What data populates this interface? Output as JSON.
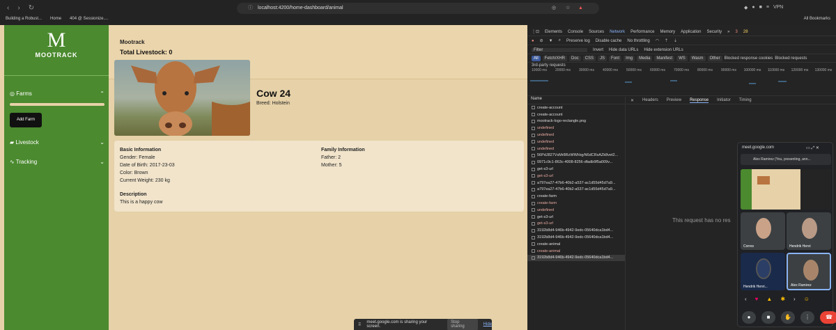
{
  "browser": {
    "back": "‹",
    "forward": "›",
    "reload": "↻",
    "url": "localhost:4200/home-dashboard/animal",
    "vpn": "VPN",
    "bookmarks": [
      "Building a Robust...",
      "Home",
      "404 @ Sessionize...."
    ],
    "all_bookmarks": "All Bookmarks"
  },
  "sidebar": {
    "logo_letter": "M",
    "logo_text": "MOOTRACK",
    "farms": "Farms",
    "add_farm": "Add Farm",
    "livestock": "Livestock",
    "tracking": "Tracking"
  },
  "header": {
    "title": "Mootrack",
    "total": "Total Livestock: 0"
  },
  "animal": {
    "name": "Cow 24",
    "breed": "Breed: Holstein",
    "basic_title": "Basic Information",
    "gender": "Gender: Female",
    "dob": "Date of Birth: 2017-23-03",
    "color": "Color: Brown",
    "weight": "Current Weight: 230 kg",
    "family_title": "Family Information",
    "father": "Father: 2",
    "mother": "Mother: 5",
    "desc_title": "Description",
    "desc": "This is a happy cow"
  },
  "devtools": {
    "tabs": [
      "Elements",
      "Console",
      "Sources",
      "Network",
      "Performance",
      "Memory",
      "Application",
      "Security"
    ],
    "active_tab": "Network",
    "errors": "3",
    "warnings": "28",
    "toolbar": [
      "Preserve log",
      "Disable cache",
      "No throttling"
    ],
    "filter_placeholder": "Filter",
    "filter_opts": [
      "Invert",
      "Hide data URLs",
      "Hide extension URLs"
    ],
    "types": [
      "All",
      "Fetch/XHR",
      "Doc",
      "CSS",
      "JS",
      "Font",
      "Img",
      "Media",
      "Manifest",
      "WS",
      "Wasm",
      "Other"
    ],
    "blocked": [
      "Blocked response cookies",
      "Blocked requests"
    ],
    "third_party": "3rd-party requests",
    "ticks": [
      "10000 ms",
      "20000 ms",
      "30000 ms",
      "40000 ms",
      "50000 ms",
      "60000 ms",
      "70000 ms",
      "80000 ms",
      "90000 ms",
      "100000 ms",
      "110000 ms",
      "120000 ms",
      "130000 ms"
    ],
    "name_header": "Name",
    "requests": [
      {
        "n": "create-account",
        "e": false
      },
      {
        "n": "create-account",
        "e": false
      },
      {
        "n": "mootrack-logo-rectangle.png",
        "e": false
      },
      {
        "n": "undefined",
        "e": true
      },
      {
        "n": "undefined",
        "e": true
      },
      {
        "n": "undefined",
        "e": true
      },
      {
        "n": "undefined",
        "e": true
      },
      {
        "n": "56PdJ827VsMr8RzWWHqyN6dCRsAZk8vet2...",
        "e": false
      },
      {
        "n": "0971c9c1-863c-4008-8256-dfadb9f5a009v...",
        "e": false
      },
      {
        "n": "get-s3-url",
        "e": false
      },
      {
        "n": "get-s3-url",
        "e": true
      },
      {
        "n": "a797ea27-47b6-40b2-a537-ac1d55d45d7a9...",
        "e": false
      },
      {
        "n": "a797ea27-47b6-40b2-a537-ac1d55d45d7a9...",
        "e": false
      },
      {
        "n": "create-farm",
        "e": false
      },
      {
        "n": "create-farm",
        "e": true
      },
      {
        "n": "undefined",
        "e": true
      },
      {
        "n": "get-s3-url",
        "e": false
      },
      {
        "n": "get-s3-url",
        "e": true
      },
      {
        "n": "3192b8d4-946b-4942-9edc-05640dca1bd4...",
        "e": false
      },
      {
        "n": "3192b8d4-946b-4942-9edc-05640dca1bd4...",
        "e": false
      },
      {
        "n": "create-animal",
        "e": false
      },
      {
        "n": "create-animal",
        "e": true
      },
      {
        "n": "3192b8d4-946b-4942-9edc-05640dca1bd4...",
        "e": false
      }
    ],
    "resp_tabs": [
      "Headers",
      "Preview",
      "Response",
      "Initiator",
      "Timing"
    ],
    "no_response": "This request has no res"
  },
  "meet": {
    "site": "meet.google.com",
    "presenting": "Alex Ramirez (You, presenting, ann...",
    "p1": "Corres",
    "p2": "Hendrik Henri",
    "p3": "Hendrik Henri...",
    "p4": "Alex Ramirez"
  },
  "share": {
    "text": "meet.google.com is sharing your screen.",
    "stop": "Stop sharing",
    "hide": "Hide"
  }
}
